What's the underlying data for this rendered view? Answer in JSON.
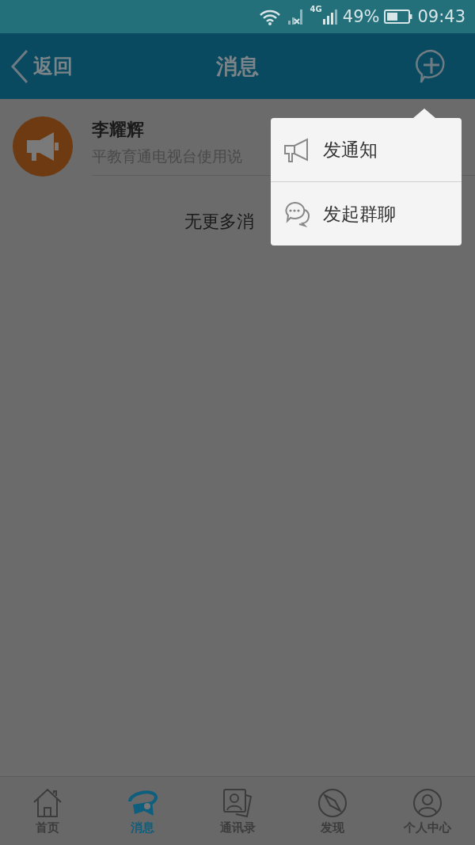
{
  "status_bar": {
    "battery": "49%",
    "time": "09:43",
    "network": "4G"
  },
  "header": {
    "back": "返回",
    "title": "消息"
  },
  "conversations": [
    {
      "name": "李耀辉",
      "preview": "平教育通电视台使用说"
    }
  ],
  "footer_note": "无更多消",
  "popup_menu": [
    {
      "kind": "notice",
      "label": "发通知"
    },
    {
      "kind": "group",
      "label": "发起群聊"
    }
  ],
  "tabs": [
    {
      "kind": "home",
      "label": "首页",
      "selected": false
    },
    {
      "kind": "message",
      "label": "消息",
      "selected": true
    },
    {
      "kind": "contacts",
      "label": "通讯录",
      "selected": false
    },
    {
      "kind": "discover",
      "label": "发现",
      "selected": false
    },
    {
      "kind": "profile",
      "label": "个人中心",
      "selected": false
    }
  ]
}
